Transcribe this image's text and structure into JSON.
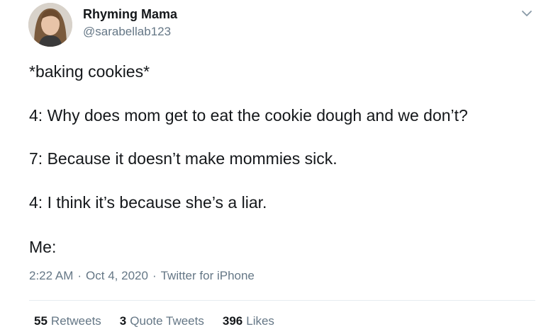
{
  "author": {
    "name": "Rhyming Mama",
    "handle": "@sarabellab123"
  },
  "tweet": {
    "lines": [
      "*baking cookies*",
      "4: Why does mom get to eat the cookie dough and we don’t?",
      "7: Because it doesn’t make mommies sick.",
      "4: I think it’s because she’s a liar.",
      "Me:"
    ]
  },
  "meta": {
    "time": "2:22 AM",
    "date": "Oct 4, 2020",
    "source": "Twitter for iPhone",
    "separator": "·"
  },
  "stats": {
    "retweets_count": "55",
    "retweets_label": "Retweets",
    "quotes_count": "3",
    "quotes_label": "Quote Tweets",
    "likes_count": "396",
    "likes_label": "Likes"
  },
  "icons": {
    "menu": "chevron-down-icon"
  }
}
